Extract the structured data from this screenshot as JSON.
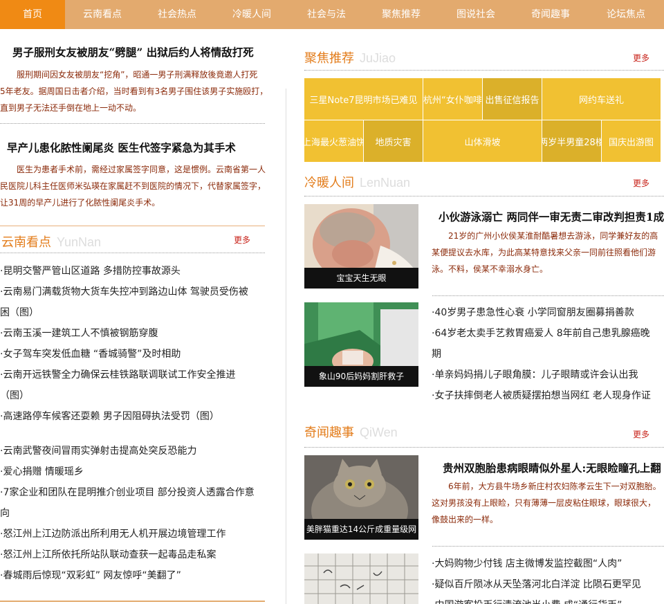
{
  "nav": [
    "首页",
    "云南看点",
    "社会热点",
    "冷暖人间",
    "社会与法",
    "聚焦推荐",
    "图说社会",
    "奇闻趣事",
    "论坛焦点"
  ],
  "left": {
    "story1": {
      "title": "男子服刑女友被朋友“劈腿” 出狱后约人将情敌打死",
      "lines": [
        "服刑期间因女友被朋友“挖角”，昭通一男子刑满释放後竟邀人打死",
        "5年老友。据周国日击者介绍，当时看到有3名男子围住该男子实施殴打，",
        "直到男子无法还手倒在地上一动不动。"
      ]
    },
    "story2": {
      "title": "早产儿患化脓性阑尾炎 医生代签字紧急为其手术",
      "lines": [
        "医生为患者手术前，需经过家属签字同意，这是惯例。云南省第一人",
        "民医院儿科主任医师米弘瑛在家属赶不到医院的情况下，代替家属签字，",
        "让31周的早产儿进行了化脓性阑尾炎手术。"
      ]
    },
    "yunnan": {
      "title": "云南看点",
      "pinyin": "YunNan",
      "more": "更多",
      "items": [
        "·昆明交警严管山区道路 多措防控事故源头",
        "·云南易门满载货物大货车失控冲到路边山体 驾驶员受伤被",
        "困（图）",
        "·云南玉溪一建筑工人不慎被钢筋穿腹",
        "·女子驾车突发低血糖 “香城骑警”及时相助",
        "·云南开远铁警全力确保云桂铁路联调联试工作安全推进",
        "（图）",
        "·高速路停车候客还耍赖 男子因阻碍执法受罚（图）",
        "",
        "·云南武警夜间冒雨实弹射击提高处突反恐能力",
        "·爱心捐赠 情暖瑶乡",
        "·7家企业和团队在昆明推介创业项目 部分投资人透露合作意",
        "向",
        "·怒江州上江边防派出所利用无人机开展边境管理工作",
        "·怒江州上江所依托所站队联动查获一起毒品走私案",
        "·春城雨后惊现“双彩虹” 网友惊呼“美翻了”"
      ]
    }
  },
  "right": {
    "jujiao": {
      "title": "聚焦推荐",
      "pinyin": "JuJiao",
      "more": "更多",
      "tiles": [
        "三星Note7昆明市场已难见",
        "杭州“女仆咖啡",
        "出售征信报告",
        "网约车送礼",
        "上海最火葱油饼",
        "地质灾害",
        "山体滑坡",
        "两岁半男童28楼",
        "国庆出游图"
      ]
    },
    "lengnuan": {
      "title": "冷暖人间",
      "pinyin": "LenNuan",
      "more": "更多",
      "photo1_caption": "宝宝天生无眼",
      "headline": "小伙游泳溺亡 两同伴一审无责二审改判担责1成",
      "lines": [
        "21岁的广州小伙侯某淮耐酷暑想去游泳，同学兼好友的高",
        "某便提议去水库，为此高某特意找来父亲一同前往照看他们游",
        "泳。不料，侯某不幸溺水身亡。"
      ],
      "photo2_caption": "象山90后妈妈割肝救子",
      "items": [
        "·40岁男子患急性心衰 小学同窗朋友圈募捐善款",
        "·64岁老太卖手艺救胃癌爱人 8年前自己患乳腺癌晚",
        "期",
        "·单亲妈妈捐儿子眼角膜：儿子眼睛或许会认出我",
        "·女子扶摔倒老人被质疑摆拍想当网红 老人现身作证"
      ]
    },
    "qiwen": {
      "title": "奇闻趣事",
      "pinyin": "QiWen",
      "more": "更多",
      "photo1_caption": "美胖猫重达14公斤成重量级网",
      "headline": "贵州双胞胎患病眼睛似外星人:无眼睑瞳孔上翻",
      "lines": [
        "6年前，大方县牛场乡新庄村农妇陈孝云生下一对双胞胎。",
        "这对男孩没有上眼睑，只有薄薄一层皮粘住眼球，眼球很大，",
        "像鼓出来的一样。"
      ],
      "items": [
        "·大妈购物少付钱 店主微博发监控截图“人肉”",
        "·疑似百斤陨冰从天坠落河北白洋淀 比陨石更罕见",
        "·中国游客投币行清流池当小费 成“通行货币”"
      ]
    }
  }
}
